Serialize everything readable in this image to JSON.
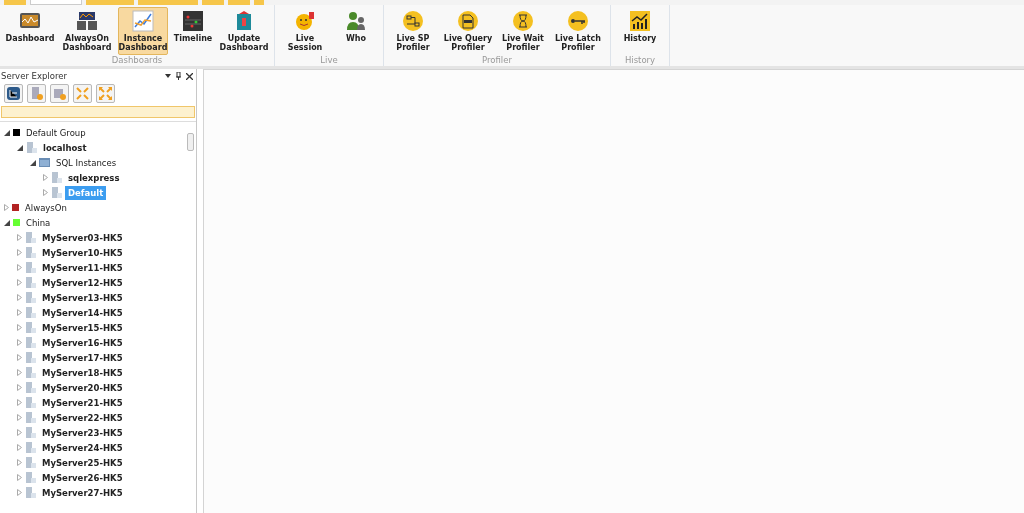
{
  "tab_strip": [
    {
      "selected": false
    },
    {
      "selected": true
    },
    {
      "selected": false
    },
    {
      "selected": false
    },
    {
      "selected": false
    },
    {
      "selected": false
    },
    {
      "selected": false
    }
  ],
  "ribbon": {
    "groups": [
      {
        "label": "Dashboards",
        "buttons": [
          {
            "label": "Dashboard",
            "selected": false
          },
          {
            "label": "AlwaysOn Dashboard",
            "selected": false
          },
          {
            "label": "Instance Dashboard",
            "selected": true
          },
          {
            "label": "Timeline",
            "selected": false
          },
          {
            "label": "Update Dashboard",
            "selected": false
          }
        ]
      },
      {
        "label": "Live",
        "buttons": [
          {
            "label": "Live Session",
            "selected": false
          },
          {
            "label": "Who",
            "selected": false
          }
        ]
      },
      {
        "label": "Profiler",
        "buttons": [
          {
            "label": "Live SP Profiler",
            "selected": false
          },
          {
            "label": "Live Query Profiler",
            "selected": false
          },
          {
            "label": "Live Wait Profiler",
            "selected": false
          },
          {
            "label": "Live Latch Profiler",
            "selected": false
          }
        ]
      },
      {
        "label": "History",
        "buttons": [
          {
            "label": "History",
            "selected": false
          }
        ]
      }
    ]
  },
  "server_explorer": {
    "title": "Server Explorer",
    "tree": [
      {
        "label": "Default Group",
        "kind": "group",
        "color": "#000000",
        "expanded": true,
        "selected": false,
        "children": [
          {
            "label": "localhost",
            "kind": "server",
            "expanded": true,
            "selected": false,
            "children": [
              {
                "label": "SQL Instances",
                "kind": "folder",
                "expanded": true,
                "selected": false,
                "children": [
                  {
                    "label": "sqlexpress",
                    "kind": "server",
                    "expanded": false,
                    "selected": false
                  },
                  {
                    "label": "Default",
                    "kind": "server",
                    "expanded": false,
                    "selected": true
                  }
                ]
              }
            ]
          }
        ]
      },
      {
        "label": "AlwaysOn",
        "kind": "group",
        "color": "#b22222",
        "expanded": false,
        "selected": false
      },
      {
        "label": "China",
        "kind": "group",
        "color": "#66ff33",
        "expanded": true,
        "selected": false,
        "children": [
          {
            "label": "MyServer03-HK5",
            "kind": "server",
            "expanded": false,
            "selected": false
          },
          {
            "label": "MyServer10-HK5",
            "kind": "server",
            "expanded": false,
            "selected": false
          },
          {
            "label": "MyServer11-HK5",
            "kind": "server",
            "expanded": false,
            "selected": false
          },
          {
            "label": "MyServer12-HK5",
            "kind": "server",
            "expanded": false,
            "selected": false
          },
          {
            "label": "MyServer13-HK5",
            "kind": "server",
            "expanded": false,
            "selected": false
          },
          {
            "label": "MyServer14-HK5",
            "kind": "server",
            "expanded": false,
            "selected": false
          },
          {
            "label": "MyServer15-HK5",
            "kind": "server",
            "expanded": false,
            "selected": false
          },
          {
            "label": "MyServer16-HK5",
            "kind": "server",
            "expanded": false,
            "selected": false
          },
          {
            "label": "MyServer17-HK5",
            "kind": "server",
            "expanded": false,
            "selected": false
          },
          {
            "label": "MyServer18-HK5",
            "kind": "server",
            "expanded": false,
            "selected": false
          },
          {
            "label": "MyServer20-HK5",
            "kind": "server",
            "expanded": false,
            "selected": false
          },
          {
            "label": "MyServer21-HK5",
            "kind": "server",
            "expanded": false,
            "selected": false
          },
          {
            "label": "MyServer22-HK5",
            "kind": "server",
            "expanded": false,
            "selected": false
          },
          {
            "label": "MyServer23-HK5",
            "kind": "server",
            "expanded": false,
            "selected": false
          },
          {
            "label": "MyServer24-HK5",
            "kind": "server",
            "expanded": false,
            "selected": false
          },
          {
            "label": "MyServer25-HK5",
            "kind": "server",
            "expanded": false,
            "selected": false
          },
          {
            "label": "MyServer26-HK5",
            "kind": "server",
            "expanded": false,
            "selected": false
          },
          {
            "label": "MyServer27-HK5",
            "kind": "server",
            "expanded": false,
            "selected": false
          }
        ]
      }
    ]
  }
}
